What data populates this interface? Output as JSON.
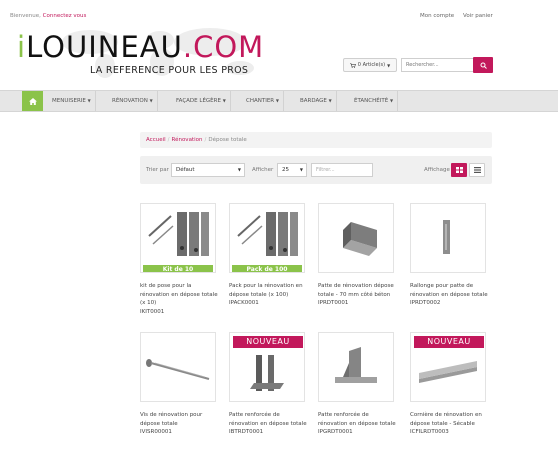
{
  "topbar": {
    "welcome": "Bienvenue,",
    "login": "Connectez vous",
    "account": "Mon compte",
    "cart": "Voir panier"
  },
  "brand": {
    "logo_i": "i",
    "logo_main": "LOUINEAU",
    "logo_com": ".COM",
    "tagline": "LA REFERENCE POUR LES PROS",
    "accent": "#c2185b",
    "green": "#8bc34a"
  },
  "header": {
    "cart_button": "0 Article(s)",
    "search_placeholder": "Rechercher..."
  },
  "nav": {
    "items": [
      {
        "label": "MENUISERIE"
      },
      {
        "label": "RÉNOVATION"
      },
      {
        "label": "FAÇADE LÉGÈRE"
      },
      {
        "label": "CHANTIER"
      },
      {
        "label": "BARDAGE"
      },
      {
        "label": "ÉTANCHÉITÉ"
      }
    ]
  },
  "breadcrumb": {
    "home": "Accueil",
    "section": "Rénovation",
    "current": "Dépose totale"
  },
  "toolbar": {
    "sort_label": "Trier par",
    "sort_value": "Défaut",
    "show_label": "Afficher",
    "show_value": "25",
    "filter_placeholder": "Filtrer...",
    "display_label": "Affichage"
  },
  "products": [
    {
      "name": "kit de pose pour la rénovation en dépose totale (x 10)",
      "ref": "IKIT0001",
      "badge": "Kit de 10"
    },
    {
      "name": "Pack pour la rénovation en dépose totale (x 100)",
      "ref": "IPACK0001",
      "badge": "Pack de 100"
    },
    {
      "name": "Patte de rénovation dépose totale - 70 mm côté béton",
      "ref": "IPRDT0001",
      "badge": ""
    },
    {
      "name": "Rallonge pour patte de rénovation en dépose totale",
      "ref": "IPRDT0002",
      "badge": ""
    },
    {
      "name": "Vis de rénovation pour dépose totale",
      "ref": "IVISR00001",
      "badge": ""
    },
    {
      "name": "Patte renforcée de rénovation en dépose totale",
      "ref": "IBTRDT0001",
      "badge": "NOUVEAU"
    },
    {
      "name": "Patte renforcée de rénovation en dépose totale",
      "ref": "IPGRDT0001",
      "badge": ""
    },
    {
      "name": "Cornière de rénovation en dépose totale - Sécable",
      "ref": "ICFILRDT0003",
      "badge": "NOUVEAU"
    }
  ]
}
